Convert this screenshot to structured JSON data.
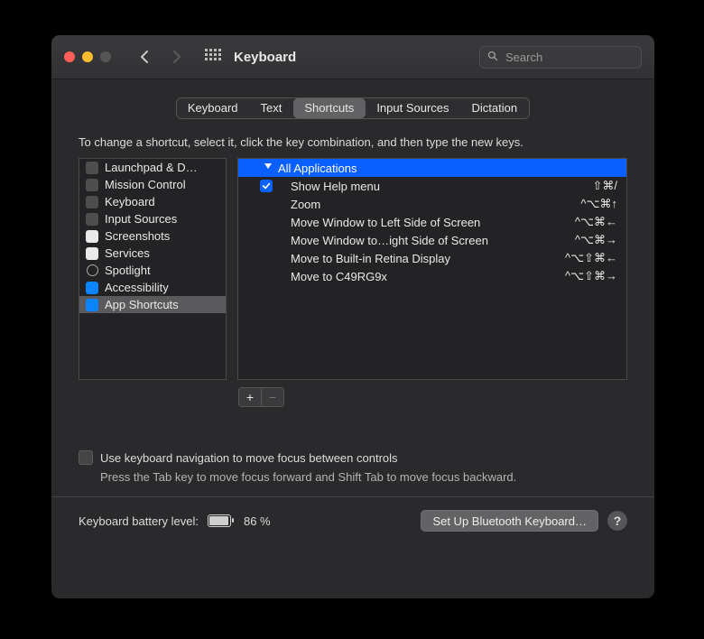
{
  "window": {
    "title": "Keyboard"
  },
  "search": {
    "placeholder": "Search"
  },
  "tabs": {
    "items": [
      "Keyboard",
      "Text",
      "Shortcuts",
      "Input Sources",
      "Dictation"
    ],
    "active_index": 2
  },
  "instructions": "To change a shortcut, select it, click the key combination, and then type the new keys.",
  "categories": {
    "items": [
      {
        "label": "Launchpad & D…",
        "icon": "launchpad"
      },
      {
        "label": "Mission Control",
        "icon": "mission"
      },
      {
        "label": "Keyboard",
        "icon": "keyboard"
      },
      {
        "label": "Input Sources",
        "icon": "input"
      },
      {
        "label": "Screenshots",
        "icon": "screenshots"
      },
      {
        "label": "Services",
        "icon": "services"
      },
      {
        "label": "Spotlight",
        "icon": "spotlight"
      },
      {
        "label": "Accessibility",
        "icon": "accessibility"
      },
      {
        "label": "App Shortcuts",
        "icon": "app"
      }
    ],
    "selected_index": 8
  },
  "shortcuts": {
    "group": "All Applications",
    "rows": [
      {
        "checked": true,
        "label": "Show Help menu",
        "keys": "⇧⌘/"
      },
      {
        "checked": false,
        "label": "Zoom",
        "keys": "^⌥⌘↑"
      },
      {
        "checked": false,
        "label": "Move Window to Left Side of Screen",
        "keys": "^⌥⌘←"
      },
      {
        "checked": false,
        "label": "Move Window to…ight Side of Screen",
        "keys": "^⌥⌘→"
      },
      {
        "checked": false,
        "label": "Move to Built-in Retina Display",
        "keys": "^⌥⇧⌘←"
      },
      {
        "checked": false,
        "label": "Move to C49RG9x",
        "keys": "^⌥⇧⌘→"
      }
    ]
  },
  "keyboard_nav": {
    "label": "Use keyboard navigation to move focus between controls",
    "hint": "Press the Tab key to move focus forward and Shift Tab to move focus backward."
  },
  "battery": {
    "label": "Keyboard battery level:",
    "percent_text": "86 %"
  },
  "buttons": {
    "bluetooth": "Set Up Bluetooth Keyboard…"
  }
}
